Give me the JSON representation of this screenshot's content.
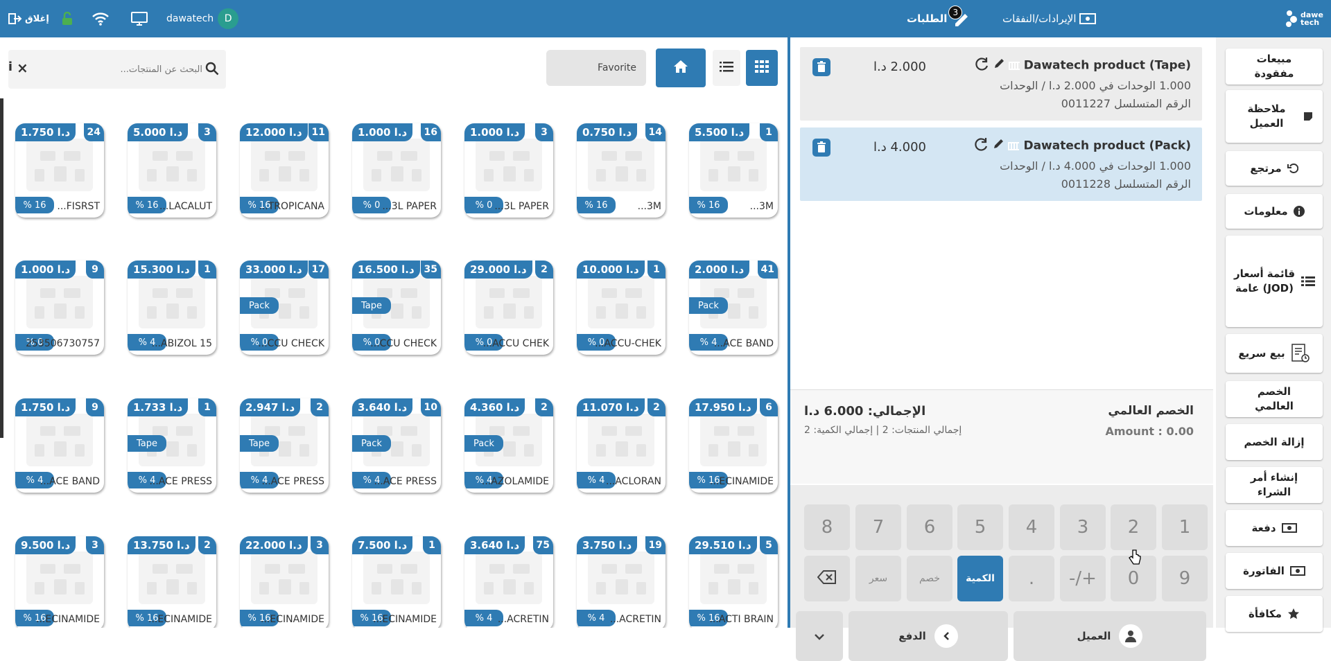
{
  "header": {
    "close_label": "إغلاق",
    "user_name": "dawatech",
    "avatar_letter": "D",
    "orders_label": "الطلبات",
    "orders_count": "3",
    "revenue_label": "الإيرادات/النفقات",
    "brand": "dawe tech"
  },
  "search": {
    "placeholder": "البحث عن المنتجات..."
  },
  "toolbar": {
    "favorite_label": "Favorite"
  },
  "products": [
    {
      "price": "5.500 د.ا",
      "qty": "1",
      "tax": "% 16",
      "unit": "",
      "name": "...3M"
    },
    {
      "price": "0.750 د.ا",
      "qty": "14",
      "tax": "% 16",
      "unit": "",
      "name": "...3M"
    },
    {
      "price": "1.000 د.ا",
      "qty": "3",
      "tax": "% 0",
      "unit": "",
      "name": "...3L PAPER"
    },
    {
      "price": "1.000 د.ا",
      "qty": "16",
      "tax": "% 0",
      "unit": "",
      "name": "...3L PAPER"
    },
    {
      "price": "12.000 د.ا",
      "qty": "11",
      "tax": "% 16",
      "unit": "",
      "name": "...TROPICANA"
    },
    {
      "price": "5.000 د.ا",
      "qty": "3",
      "tax": "% 16",
      "unit": "",
      "name": "...LACALUT"
    },
    {
      "price": "1.750 د.ا",
      "qty": "24",
      "tax": "% 16",
      "unit": "",
      "name": "...FISRST"
    },
    {
      "price": "2.000 د.ا",
      "qty": "41",
      "tax": "% 4",
      "unit": "Pack",
      "name": "...ACE BAND"
    },
    {
      "price": "10.000 د.ا",
      "qty": "1",
      "tax": "% 0",
      "unit": "",
      "name": "...ACCU-CHEK"
    },
    {
      "price": "29.000 د.ا",
      "qty": "2",
      "tax": "% 0",
      "unit": "",
      "name": "...ACCU CHEK"
    },
    {
      "price": "16.500 د.ا",
      "qty": "35",
      "tax": "% 0",
      "unit": "Tape",
      "name": "...CCU CHECK"
    },
    {
      "price": "33.000 د.ا",
      "qty": "17",
      "tax": "% 0",
      "unit": "Pack",
      "name": "...CCU CHECK"
    },
    {
      "price": "15.300 د.ا",
      "qty": "1",
      "tax": "% 4",
      "unit": "",
      "name": "...ABIZOL 15"
    },
    {
      "price": "1.000 د.ا",
      "qty": "9",
      "tax": "% 0",
      "unit": "",
      "name": "253506730757"
    },
    {
      "price": "17.950 د.ا",
      "qty": "6",
      "tax": "% 16",
      "unit": "",
      "name": "...ECINAMIDE"
    },
    {
      "price": "11.070 د.ا",
      "qty": "2",
      "tax": "% 4",
      "unit": "",
      "name": "...ACLORAN"
    },
    {
      "price": "4.360 د.ا",
      "qty": "2",
      "tax": "% 4",
      "unit": "Pack",
      "name": "...AZOLAMIDE"
    },
    {
      "price": "3.640 د.ا",
      "qty": "10",
      "tax": "% 4",
      "unit": "Pack",
      "name": "...ACE PRESS"
    },
    {
      "price": "2.947 د.ا",
      "qty": "2",
      "tax": "% 4",
      "unit": "Tape",
      "name": "...ACE PRESS"
    },
    {
      "price": "1.733 د.ا",
      "qty": "1",
      "tax": "% 4",
      "unit": "Tape",
      "name": "...ACE PRESS"
    },
    {
      "price": "1.750 د.ا",
      "qty": "9",
      "tax": "% 4",
      "unit": "",
      "name": "...ACE BAND"
    },
    {
      "price": "29.510 د.ا",
      "qty": "5",
      "tax": "% 16",
      "unit": "",
      "name": "...ACTI BRAIN"
    },
    {
      "price": "3.750 د.ا",
      "qty": "19",
      "tax": "% 4",
      "unit": "",
      "name": "...ACRETIN"
    },
    {
      "price": "3.640 د.ا",
      "qty": "75",
      "tax": "% 4",
      "unit": "",
      "name": "...ACRETIN"
    },
    {
      "price": "7.500 د.ا",
      "qty": "1",
      "tax": "% 16",
      "unit": "",
      "name": "...ECINAMIDE"
    },
    {
      "price": "22.000 د.ا",
      "qty": "3",
      "tax": "% 16",
      "unit": "",
      "name": "...ECINAMIDE"
    },
    {
      "price": "13.750 د.ا",
      "qty": "2",
      "tax": "% 16",
      "unit": "",
      "name": "...ECINAMIDE"
    },
    {
      "price": "9.500 د.ا",
      "qty": "3",
      "tax": "% 16",
      "unit": "",
      "name": "...ECINAMIDE"
    }
  ],
  "order_lines": [
    {
      "title": "Dawatech product (Tape)",
      "price": "2.000 د.ا",
      "line1": "1.000 الوحدات في 2.000 د.ا / الوحدات",
      "line2": "الرقم المتسلسل 0011227",
      "selected": false
    },
    {
      "title": "Dawatech product (Pack)",
      "price": "4.000 د.ا",
      "line1": "1.000 الوحدات في 4.000 د.ا / الوحدات",
      "line2": "الرقم المتسلسل 0011228",
      "selected": true
    }
  ],
  "summary": {
    "total": "الإجمالي: 6.000 د.ا",
    "global_discount": "الخصم العالمي",
    "products_count": "إجمالي المنتجات: 2 | إجمالي الكمية: 2",
    "amount": "Amount : 0.00"
  },
  "numpad": {
    "row1": [
      "8",
      "7",
      "6",
      "5",
      "4",
      "3",
      "2",
      "1"
    ],
    "price": "سعر",
    "discount": "خصم",
    "quantity": "الكمية",
    "dot": ".",
    "plusminus": "-/+",
    "zero": "0",
    "nine": "9"
  },
  "actions": {
    "customer": "العميل",
    "payment": "الدفع"
  },
  "sidebar": [
    "مبيعات مفقودة",
    "ملاحظة العميل",
    "مرتجع",
    "معلومات",
    "قائمة أسعار عامة (JOD)",
    "بيع سريع",
    "الخصم العالمي",
    "إزالة الخصم",
    "إنشاء أمر الشراء",
    "دفعة",
    "الفاتورة",
    "مكافأة"
  ],
  "colors": {
    "primary": "#2f7bb3",
    "selected_line": "#d4e6f3",
    "sidebar_bg": "#f0f0f0",
    "key_bg": "#dedede"
  }
}
